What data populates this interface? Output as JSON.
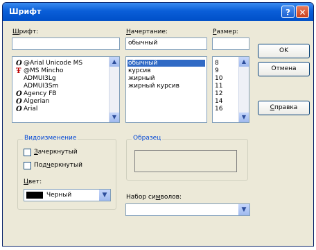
{
  "window": {
    "title": "Шрифт",
    "help": "?",
    "close": "✕"
  },
  "font": {
    "label_pre": "",
    "label_u": "Ш",
    "label_post": "рифт:",
    "value": "",
    "items": [
      {
        "icon": "O",
        "name": "@Arial Unicode MS"
      },
      {
        "icon": "Ŧ",
        "name": "@MS Mincho"
      },
      {
        "icon": "",
        "name": "ADMUI3Lg"
      },
      {
        "icon": "",
        "name": "ADMUI3Sm"
      },
      {
        "icon": "O",
        "name": "Agency FB"
      },
      {
        "icon": "O",
        "name": "Algerian"
      },
      {
        "icon": "O",
        "name": "Arial"
      }
    ]
  },
  "style": {
    "label_pre": "",
    "label_u": "Н",
    "label_post": "ачертание:",
    "value": "обычный",
    "items": [
      "обычный",
      "курсив",
      "жирный",
      "жирный курсив"
    ]
  },
  "size": {
    "label_pre": "",
    "label_u": "Р",
    "label_post": "азмер:",
    "value": "",
    "items": [
      "8",
      "9",
      "10",
      "11",
      "12",
      "14",
      "16"
    ]
  },
  "buttons": {
    "ok": "OK",
    "cancel": "Отмена",
    "help_pre": "",
    "help_u": "С",
    "help_post": "правка"
  },
  "effects": {
    "title": "Видоизменение",
    "strike_pre": "",
    "strike_u": "З",
    "strike_post": "ачеркнутый",
    "underline_pre": "Под",
    "underline_u": "ч",
    "underline_post": "еркнутый",
    "color_pre": "",
    "color_u": "Ц",
    "color_post": "вет:",
    "color_value": "Черный",
    "color_swatch": "#000000"
  },
  "sample": {
    "title": "Образец"
  },
  "charset": {
    "label_pre": "Набор си",
    "label_u": "м",
    "label_post": "волов:",
    "value": ""
  },
  "icons": {
    "scroll_up": "▲",
    "scroll_down": "▼",
    "combo": "▼"
  }
}
